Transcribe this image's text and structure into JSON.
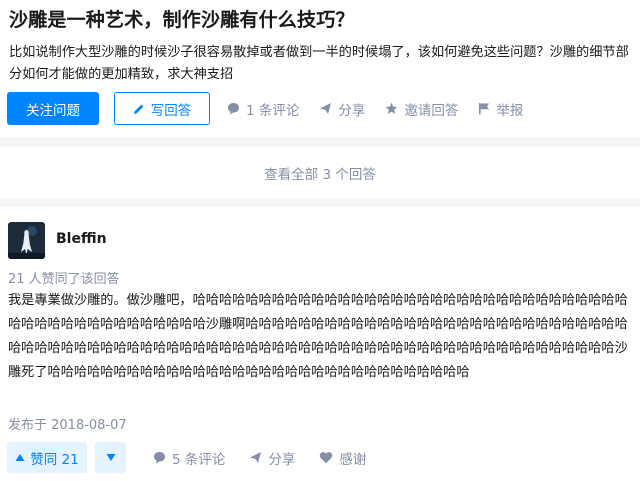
{
  "question": {
    "title": "沙雕是一种艺术，制作沙雕有什么技巧？",
    "detail": "比如说制作大型沙雕的时候沙子很容易散掉或者做到一半的时候塌了，该如何避免这些问题？沙雕的细节部分如何才能做的更加精致，求大神支招",
    "actions": {
      "follow": "关注问题",
      "write_answer": "写回答",
      "comments": "1 条评论",
      "share": "分享",
      "invite": "邀请回答",
      "report": "举报"
    }
  },
  "see_all": "查看全部 3 个回答",
  "answer": {
    "author": "Bleffin",
    "upvote_info": "21 人赞同了该回答",
    "content": "我是專業做沙雕的。做沙雕吧，哈哈哈哈哈哈哈哈哈哈哈哈哈哈哈哈哈哈哈哈哈哈哈哈哈哈哈哈哈哈哈哈哈哈哈哈哈哈哈哈哈哈哈哈哈哈哈哈沙雕啊哈哈哈哈哈哈哈哈哈哈哈哈哈哈哈哈哈哈哈哈哈哈哈哈哈哈哈哈哈哈哈哈哈哈哈哈哈哈哈哈哈哈哈哈哈哈哈哈哈哈哈哈哈哈哈哈哈哈哈哈哈哈哈哈哈哈哈哈哈哈哈哈哈哈哈沙雕死了哈哈哈哈哈哈哈哈哈哈哈哈哈哈哈哈哈哈哈哈哈哈哈哈哈哈哈哈哈哈哈哈",
    "published": "发布于 2018-08-07",
    "actions": {
      "upvote": "赞同 21",
      "comments": "5 条评论",
      "share": "分享",
      "thanks": "感谢"
    }
  },
  "colors": {
    "primary": "#0084ff",
    "muted": "#8590a6",
    "vote_bg": "#e5f2ff"
  }
}
